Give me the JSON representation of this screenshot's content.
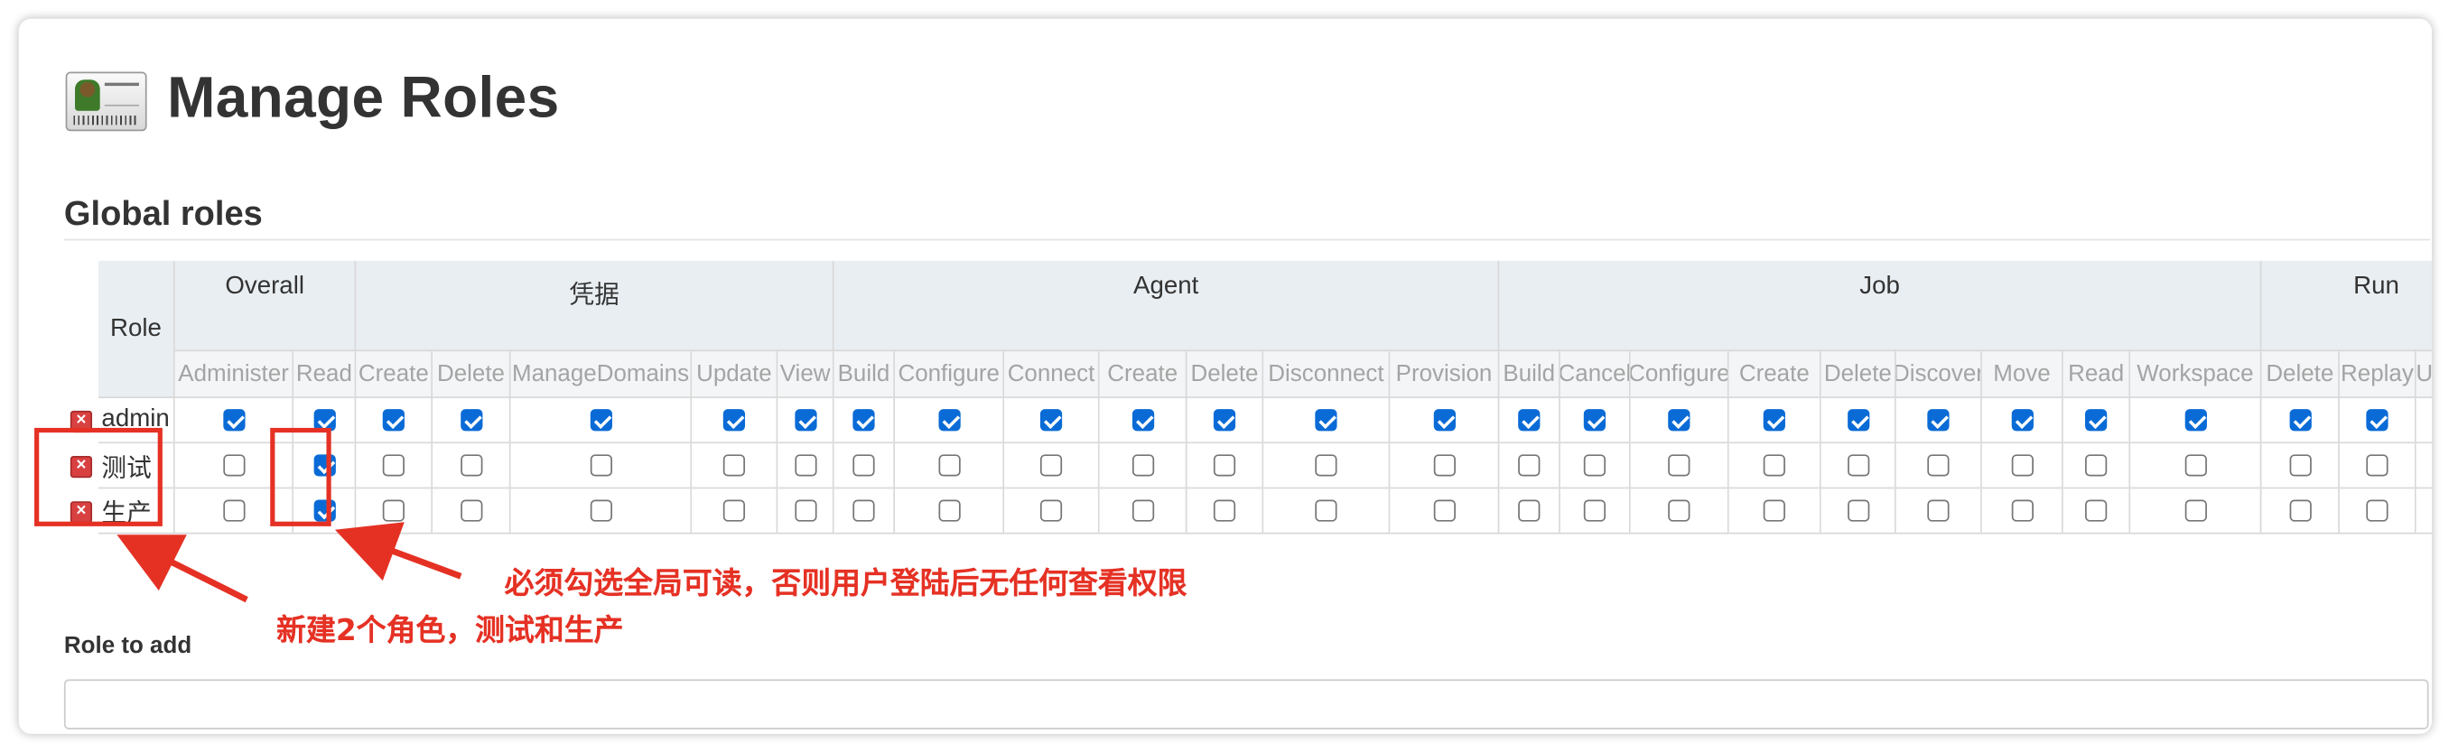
{
  "page": {
    "title": "Manage Roles"
  },
  "global_roles": {
    "title": "Global roles",
    "role_header": "Role",
    "groups": [
      {
        "label": "Overall",
        "perms": [
          "Administer",
          "Read"
        ]
      },
      {
        "label": "凭据",
        "perms": [
          "Create",
          "Delete",
          "ManageDomains",
          "Update",
          "View"
        ]
      },
      {
        "label": "Agent",
        "perms": [
          "Build",
          "Configure",
          "Connect",
          "Create",
          "Delete",
          "Disconnect",
          "Provision"
        ]
      },
      {
        "label": "Job",
        "perms": [
          "Build",
          "Cancel",
          "Configure",
          "Create",
          "Delete",
          "Discover",
          "Move",
          "Read",
          "Workspace"
        ]
      },
      {
        "label": "Run",
        "perms": [
          "Delete",
          "Replay",
          "Update"
        ]
      }
    ],
    "rows": [
      {
        "name": "admin",
        "checks": [
          1,
          1,
          1,
          1,
          1,
          1,
          1,
          1,
          1,
          1,
          1,
          1,
          1,
          1,
          1,
          1,
          1,
          1,
          1,
          1,
          1,
          1,
          1,
          1,
          1,
          1
        ]
      },
      {
        "name": "测试",
        "checks": [
          0,
          1,
          0,
          0,
          0,
          0,
          0,
          0,
          0,
          0,
          0,
          0,
          0,
          0,
          0,
          0,
          0,
          0,
          0,
          0,
          0,
          0,
          0,
          0,
          0,
          0
        ]
      },
      {
        "name": "生产",
        "checks": [
          0,
          1,
          0,
          0,
          0,
          0,
          0,
          0,
          0,
          0,
          0,
          0,
          0,
          0,
          0,
          0,
          0,
          0,
          0,
          0,
          0,
          0,
          0,
          0,
          0,
          0
        ]
      }
    ]
  },
  "annotations": {
    "read_note": "必须勾选全局可读，否则用户登陆后无任何查看权限",
    "new_roles_note": "新建2个角色，测试和生产"
  },
  "add_role": {
    "label": "Role to add",
    "value": ""
  },
  "colors": {
    "annotation": "#e53124",
    "checkbox": "#0a6bd6",
    "header_bg": "#e9eef2"
  },
  "icons": {
    "page": "user-card-icon",
    "delete": "delete-role-icon"
  }
}
